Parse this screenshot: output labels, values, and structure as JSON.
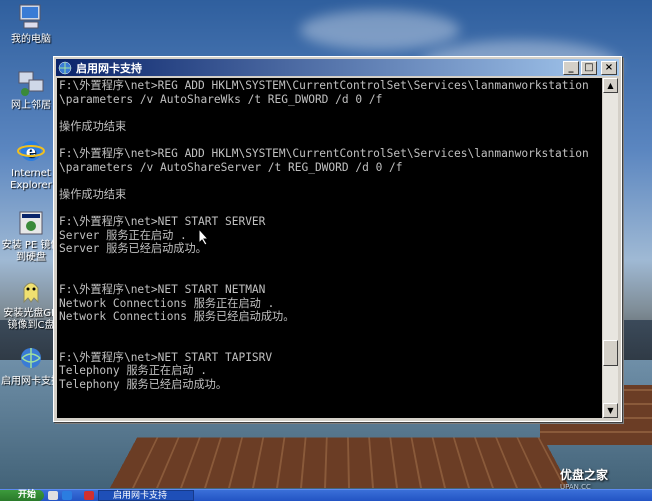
{
  "desktop": {
    "icons": [
      {
        "label": "我的电脑",
        "icon": "my-computer-icon"
      },
      {
        "label": "网上邻居",
        "icon": "network-places-icon"
      },
      {
        "label_line1": "Internet",
        "label_line2": "Explorer",
        "icon": "internet-explorer-icon"
      },
      {
        "label_line1": "安装 PE 镜像",
        "label_line2": "到硬盘",
        "icon": "install-pe-icon"
      },
      {
        "label_line1": "安装光盘GH",
        "label_line2": "镜像到C盘",
        "icon": "install-ghost-icon"
      },
      {
        "label": "启用网卡支持",
        "icon": "enable-nic-icon"
      }
    ]
  },
  "window": {
    "title": "启用网卡支持",
    "buttons": {
      "minimize": "_",
      "maximize": "□",
      "close": "×"
    }
  },
  "console": {
    "lines": [
      "F:\\外置程序\\net>REG ADD HKLM\\SYSTEM\\CurrentControlSet\\Services\\lanmanworkstation",
      "\\parameters /v AutoShareWks /t REG_DWORD /d 0 /f",
      "",
      "操作成功结束",
      "",
      "F:\\外置程序\\net>REG ADD HKLM\\SYSTEM\\CurrentControlSet\\Services\\lanmanworkstation",
      "\\parameters /v AutoShareServer /t REG_DWORD /d 0 /f",
      "",
      "操作成功结束",
      "",
      "F:\\外置程序\\net>NET START SERVER",
      "Server 服务正在启动 .",
      "Server 服务已经启动成功。",
      "",
      "",
      "F:\\外置程序\\net>NET START NETMAN",
      "Network Connections 服务正在启动 .",
      "Network Connections 服务已经启动成功。",
      "",
      "",
      "F:\\外置程序\\net>NET START TAPISRV",
      "Telephony 服务正在启动 .",
      "Telephony 服务已经启动成功。"
    ]
  },
  "taskbar": {
    "start_label": "开始",
    "task_label": "启用网卡支持"
  },
  "watermark": {
    "text": "优盘之家",
    "sub": "UPAN.CC"
  },
  "colors": {
    "titlebar_start": "#0a246a",
    "titlebar_end": "#a6caf0",
    "console_bg": "#000000",
    "console_fg": "#c0c0c0",
    "taskbar": "#2354c4"
  }
}
